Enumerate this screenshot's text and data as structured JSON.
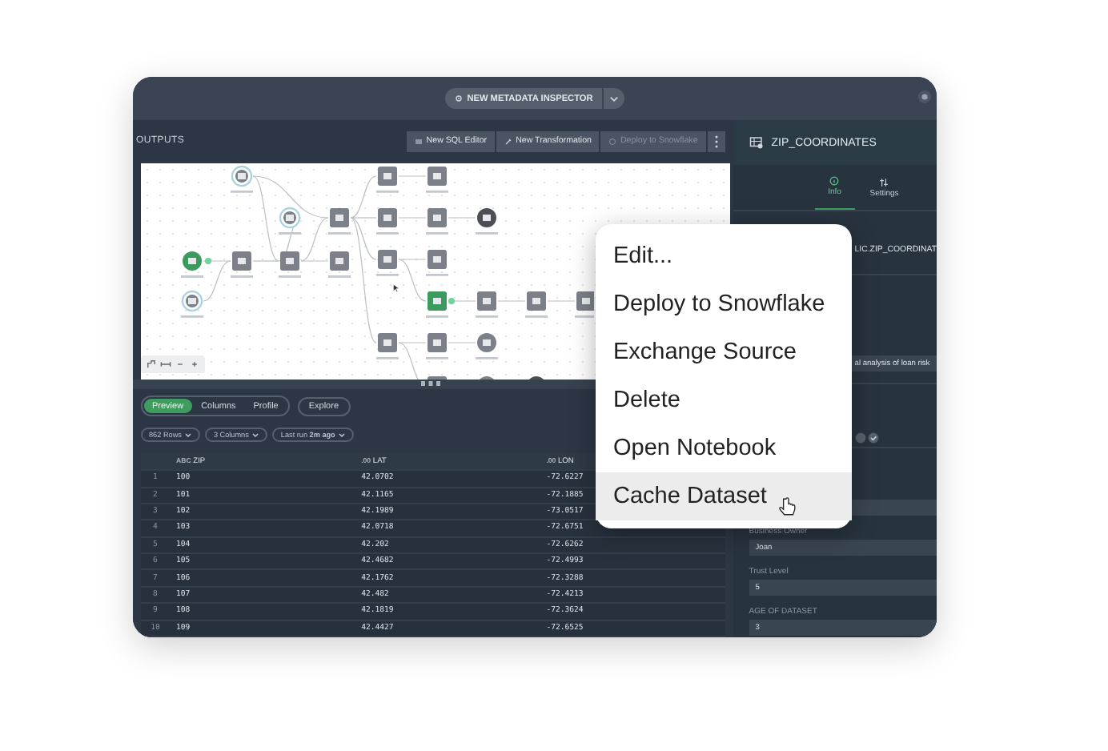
{
  "top_bar": {
    "inspector_button": "NEW METADATA INSPECTOR"
  },
  "toolbar": {
    "section_title": "OUTPUTS",
    "buttons": [
      {
        "label": "New SQL Editor",
        "kind": "sql",
        "disabled": false
      },
      {
        "label": "New Transformation",
        "kind": "transform",
        "disabled": false
      },
      {
        "label": "Deploy to Snowflake",
        "kind": "deploy",
        "disabled": true
      }
    ]
  },
  "preview": {
    "tabs": [
      {
        "label": "Preview",
        "selected": true
      },
      {
        "label": "Columns",
        "selected": false
      },
      {
        "label": "Profile",
        "selected": false
      }
    ],
    "explore_button": "Explore",
    "filters": [
      "862 Rows",
      "3 Columns",
      "Last run **2m ago**"
    ],
    "table": {
      "columns": [
        {
          "type": "ABC",
          "label": "ZIP"
        },
        {
          "type": ".00",
          "label": "LAT"
        },
        {
          "type": ".00",
          "label": "LON"
        }
      ],
      "rows": [
        {
          "index": "1",
          "cells": [
            "100",
            "42.0702",
            "-72.6227"
          ]
        },
        {
          "index": "2",
          "cells": [
            "101",
            "42.1165",
            "-72.1885"
          ]
        },
        {
          "index": "3",
          "cells": [
            "102",
            "42.1989",
            "-73.0517"
          ]
        },
        {
          "index": "4",
          "cells": [
            "103",
            "42.0718",
            "-72.6751"
          ]
        },
        {
          "index": "5",
          "cells": [
            "104",
            "42.202",
            "-72.6262"
          ]
        },
        {
          "index": "6",
          "cells": [
            "105",
            "42.4682",
            "-72.4993"
          ]
        },
        {
          "index": "7",
          "cells": [
            "106",
            "42.1762",
            "-72.3288"
          ]
        },
        {
          "index": "8",
          "cells": [
            "107",
            "42.482",
            "-72.4213"
          ]
        },
        {
          "index": "9",
          "cells": [
            "108",
            "42.1819",
            "-72.3624"
          ]
        },
        {
          "index": "10",
          "cells": [
            "109",
            "42.4427",
            "-72.6525"
          ]
        }
      ]
    }
  },
  "context_menu": {
    "items": [
      {
        "label": "Edit...",
        "selected": false
      },
      {
        "label": "Deploy to Snowflake",
        "selected": false
      },
      {
        "label": "Exchange Source",
        "selected": false
      },
      {
        "label": "Delete",
        "selected": false
      },
      {
        "label": "Open Notebook",
        "selected": false
      },
      {
        "label": "Cache Dataset",
        "selected": true
      }
    ]
  },
  "details_panel": {
    "title": "ZIP_COORDINATES",
    "tabs": [
      {
        "label": "Info",
        "kind": "info",
        "selected": true
      },
      {
        "label": "Settings",
        "kind": "settings",
        "selected": false
      }
    ],
    "path_value": "LIC.ZIP_COORDINAT",
    "description_value": "al analysis of loan risk",
    "fields": [
      {
        "label": "Business Owner",
        "value": "Joan"
      },
      {
        "label": "Trust Level",
        "value": "5"
      },
      {
        "label": "AGE OF DATASET",
        "value": "3"
      }
    ]
  }
}
